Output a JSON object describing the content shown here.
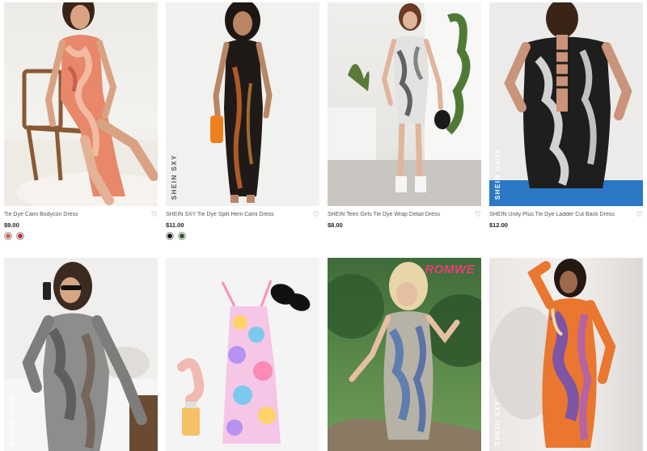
{
  "products_row1": [
    {
      "title": "Tie Dye Cami Bodycon Dress",
      "price": "$9.00",
      "swatches": [
        "#c86a4a",
        "#c0303a"
      ]
    },
    {
      "title": "SHEIN SXY Tie Dye Split Hem Cami Dress",
      "price": "$11.00",
      "brand_mark": "SHEIN SXY",
      "swatches": [
        "#1a1a1a",
        "#2f5a2a"
      ]
    },
    {
      "title": "SHEIN Teen Girls Tie Dye Wrap Detail Dress",
      "price": "$8.00"
    },
    {
      "title": "SHEIN Unity Plus Tie Dye Ladder Cut Back Dress",
      "price": "$12.00",
      "brand_mark": "SHEIN Unity"
    }
  ],
  "products_row2": [
    {
      "brand_mark": "SHEIN ICON"
    },
    {},
    {
      "brand_mark": "ROMWE"
    },
    {
      "brand_mark": "SHEIN SXY"
    }
  ],
  "icons": {
    "wishlist": "heart-outline-icon"
  },
  "heart_glyph": "♡"
}
